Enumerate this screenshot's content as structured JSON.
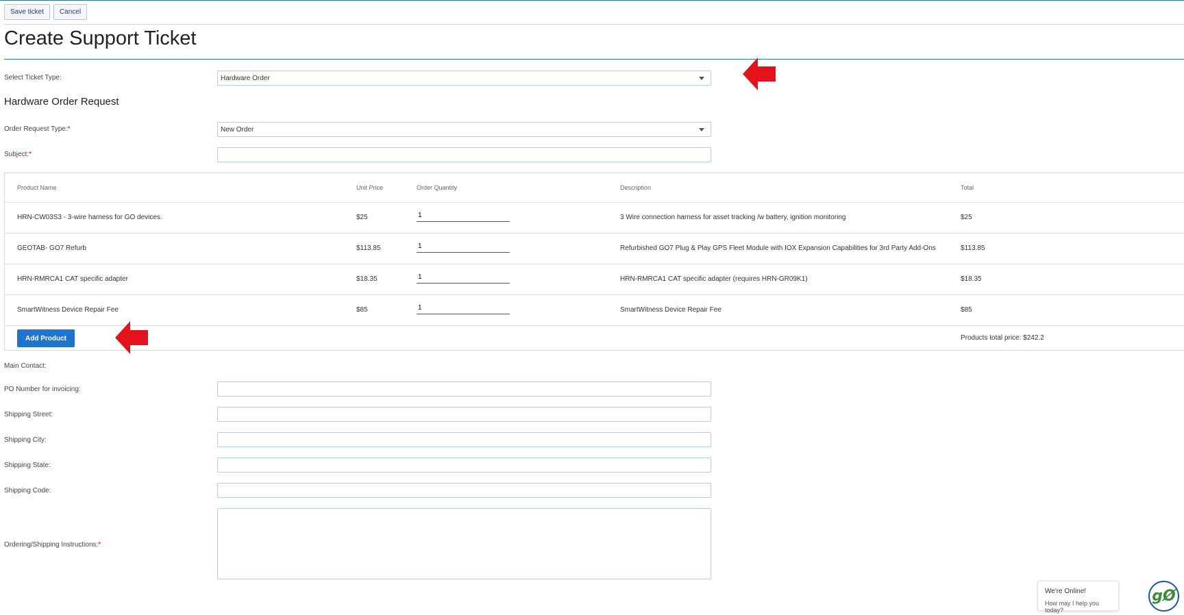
{
  "toolbar": {
    "save_label": "Save ticket",
    "cancel_label": "Cancel"
  },
  "page": {
    "title": "Create Support Ticket"
  },
  "ticket_type": {
    "label": "Select Ticket Type:",
    "value": "Hardware Order"
  },
  "section": {
    "title": "Hardware Order Request"
  },
  "order_request_type": {
    "label": "Order Request Type:",
    "required_mark": "*",
    "value": "New Order"
  },
  "subject": {
    "label": "Subject:",
    "required_mark": "*",
    "value": ""
  },
  "products": {
    "headers": {
      "name": "Product Name",
      "unit_price": "Unit Price",
      "quantity": "Order Quantity",
      "description": "Description",
      "total": "Total"
    },
    "rows": [
      {
        "name": "HRN-CW03S3 - 3-wire harness for GO devices.",
        "unit_price": "$25",
        "quantity": "1",
        "description": "3 Wire connection harness for asset tracking /w battery, ignition monitoring",
        "total": "$25"
      },
      {
        "name": "GEOTAB- GO7 Refurb",
        "unit_price": "$113.85",
        "quantity": "1",
        "description": "Refurbished GO7 Plug & Play GPS Fleet Module with IOX Expansion Capabilities for 3rd Party Add-Ons",
        "total": "$113.85"
      },
      {
        "name": "HRN-RMRCA1 CAT specific adapter",
        "unit_price": "$18.35",
        "quantity": "1",
        "description": "HRN-RMRCA1 CAT specific adapter (requires HRN-GR09K1)",
        "total": "$18.35"
      },
      {
        "name": "SmartWitness Device Repair Fee",
        "unit_price": "$85",
        "quantity": "1",
        "description": "SmartWitness Device Repair Fee",
        "total": "$85"
      }
    ],
    "add_label": "Add Product",
    "total_price_text": "Products total price: $242.2"
  },
  "contact": {
    "main_contact_label": "Main Contact:",
    "po_label": "PO Number for invoicing:",
    "street_label": "Shipping Street:",
    "city_label": "Shipping City:",
    "state_label": "Shipping State:",
    "code_label": "Shipping Code:",
    "instructions_label": "Ordering/Shipping Instructions:",
    "instructions_required_mark": "*"
  },
  "chat": {
    "title": "We're Online!",
    "subtitle": "How may I help you today?",
    "logo_text": "gØ"
  },
  "colors": {
    "accent": "#1f75c9",
    "arrow": "#e3121b",
    "required": "#d0021b"
  }
}
